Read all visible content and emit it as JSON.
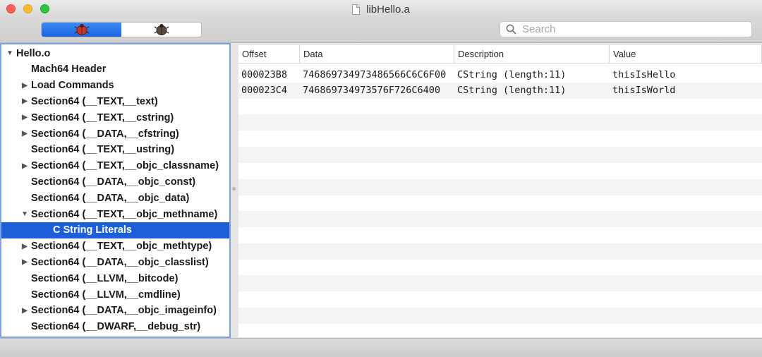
{
  "window": {
    "title": "libHello.a"
  },
  "toolbar": {
    "segments": [
      {
        "icon": "bug-red-icon",
        "selected": true
      },
      {
        "icon": "bug-dark-icon",
        "selected": false
      }
    ],
    "search": {
      "placeholder": "Search",
      "value": ""
    }
  },
  "colors": {
    "selection": "#1d5fd6",
    "focus_ring": "#7da2ea",
    "segment_active": "#2e7df0"
  },
  "tree": {
    "items": [
      {
        "label": "Hello.o",
        "disclosure": "expanded",
        "selected": false
      },
      {
        "label": "Mach64 Header",
        "disclosure": "none",
        "selected": false
      },
      {
        "label": "Load Commands",
        "disclosure": "collapsed",
        "selected": false
      },
      {
        "label": "Section64 (__TEXT,__text)",
        "disclosure": "collapsed",
        "selected": false
      },
      {
        "label": "Section64 (__TEXT,__cstring)",
        "disclosure": "collapsed",
        "selected": false
      },
      {
        "label": "Section64 (__DATA,__cfstring)",
        "disclosure": "collapsed",
        "selected": false
      },
      {
        "label": "Section64 (__TEXT,__ustring)",
        "disclosure": "none",
        "selected": false
      },
      {
        "label": "Section64 (__TEXT,__objc_classname)",
        "disclosure": "collapsed",
        "selected": false
      },
      {
        "label": "Section64 (__DATA,__objc_const)",
        "disclosure": "none",
        "selected": false
      },
      {
        "label": "Section64 (__DATA,__objc_data)",
        "disclosure": "none",
        "selected": false
      },
      {
        "label": "Section64 (__TEXT,__objc_methname)",
        "disclosure": "expanded",
        "selected": false
      },
      {
        "label": "C String Literals",
        "disclosure": "none",
        "selected": true
      },
      {
        "label": "Section64 (__TEXT,__objc_methtype)",
        "disclosure": "collapsed",
        "selected": false
      },
      {
        "label": "Section64 (__DATA,__objc_classlist)",
        "disclosure": "collapsed",
        "selected": false
      },
      {
        "label": "Section64 (__LLVM,__bitcode)",
        "disclosure": "none",
        "selected": false
      },
      {
        "label": "Section64 (__LLVM,__cmdline)",
        "disclosure": "none",
        "selected": false
      },
      {
        "label": "Section64 (__DATA,__objc_imageinfo)",
        "disclosure": "collapsed",
        "selected": false
      },
      {
        "label": "Section64 (__DWARF,__debug_str)",
        "disclosure": "none",
        "selected": false
      }
    ]
  },
  "table": {
    "columns": [
      "Offset",
      "Data",
      "Description",
      "Value"
    ],
    "rows": [
      [
        "000023B8",
        "746869734973486566C6C6F00",
        "CString (length:11)",
        "thisIsHello"
      ],
      [
        "000023C4",
        "746869734973576F726C6400",
        "CString (length:11)",
        "thisIsWorld"
      ]
    ]
  }
}
